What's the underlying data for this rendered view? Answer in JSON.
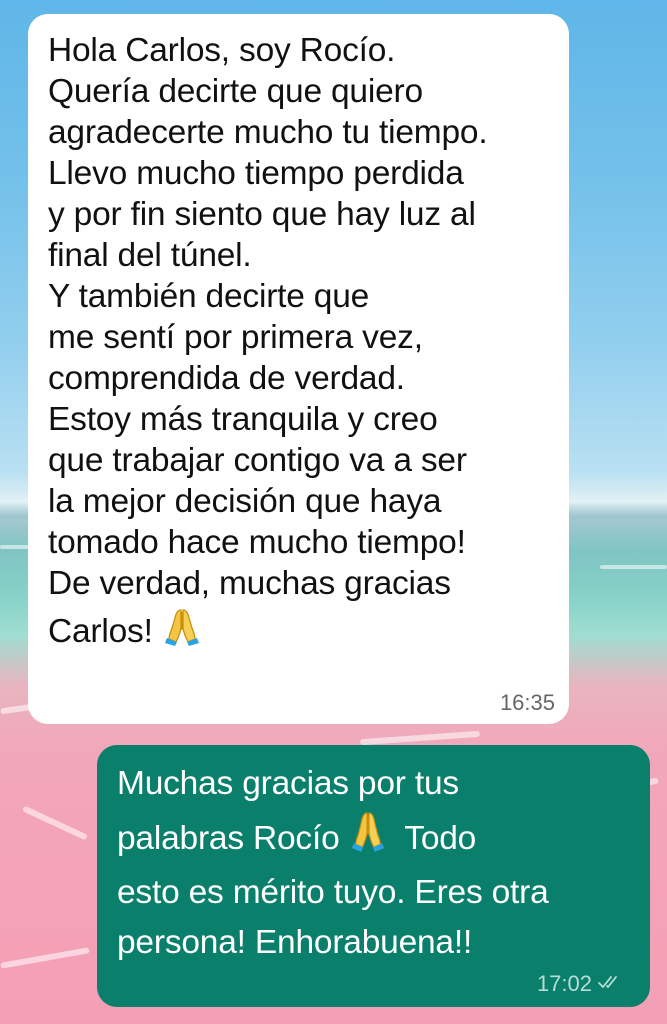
{
  "chat": {
    "incoming": {
      "lines": [
        "Hola Carlos, soy Rocío.",
        "Quería decirte que quiero",
        "agradecerte mucho tu tiempo.",
        "Llevo mucho tiempo perdida",
        "y por fin siento que hay luz al",
        "final del túnel.",
        "Y también decirte que",
        "me sentí por primera vez,",
        "comprendida de verdad.",
        "Estoy más tranquila y creo",
        "que trabajar contigo va a ser",
        "la mejor decisión que haya",
        "tomado hace mucho tiempo!",
        "De verdad, muchas gracias"
      ],
      "last_line": "Carlos!",
      "emoji": "folded-hands",
      "time": "16:35"
    },
    "outgoing": {
      "line1": "Muchas gracias por tus",
      "line2_before": "palabras Rocío",
      "line2_after": "Todo",
      "line3": "esto es mérito tuyo. Eres otra",
      "line4": "persona! Enhorabuena!!",
      "emoji": "folded-hands",
      "time": "17:02",
      "status": "read-double-check"
    }
  },
  "colors": {
    "incoming_bubble": "#ffffff",
    "outgoing_bubble": "#0a7f6c",
    "outgoing_text": "#ffffff"
  }
}
